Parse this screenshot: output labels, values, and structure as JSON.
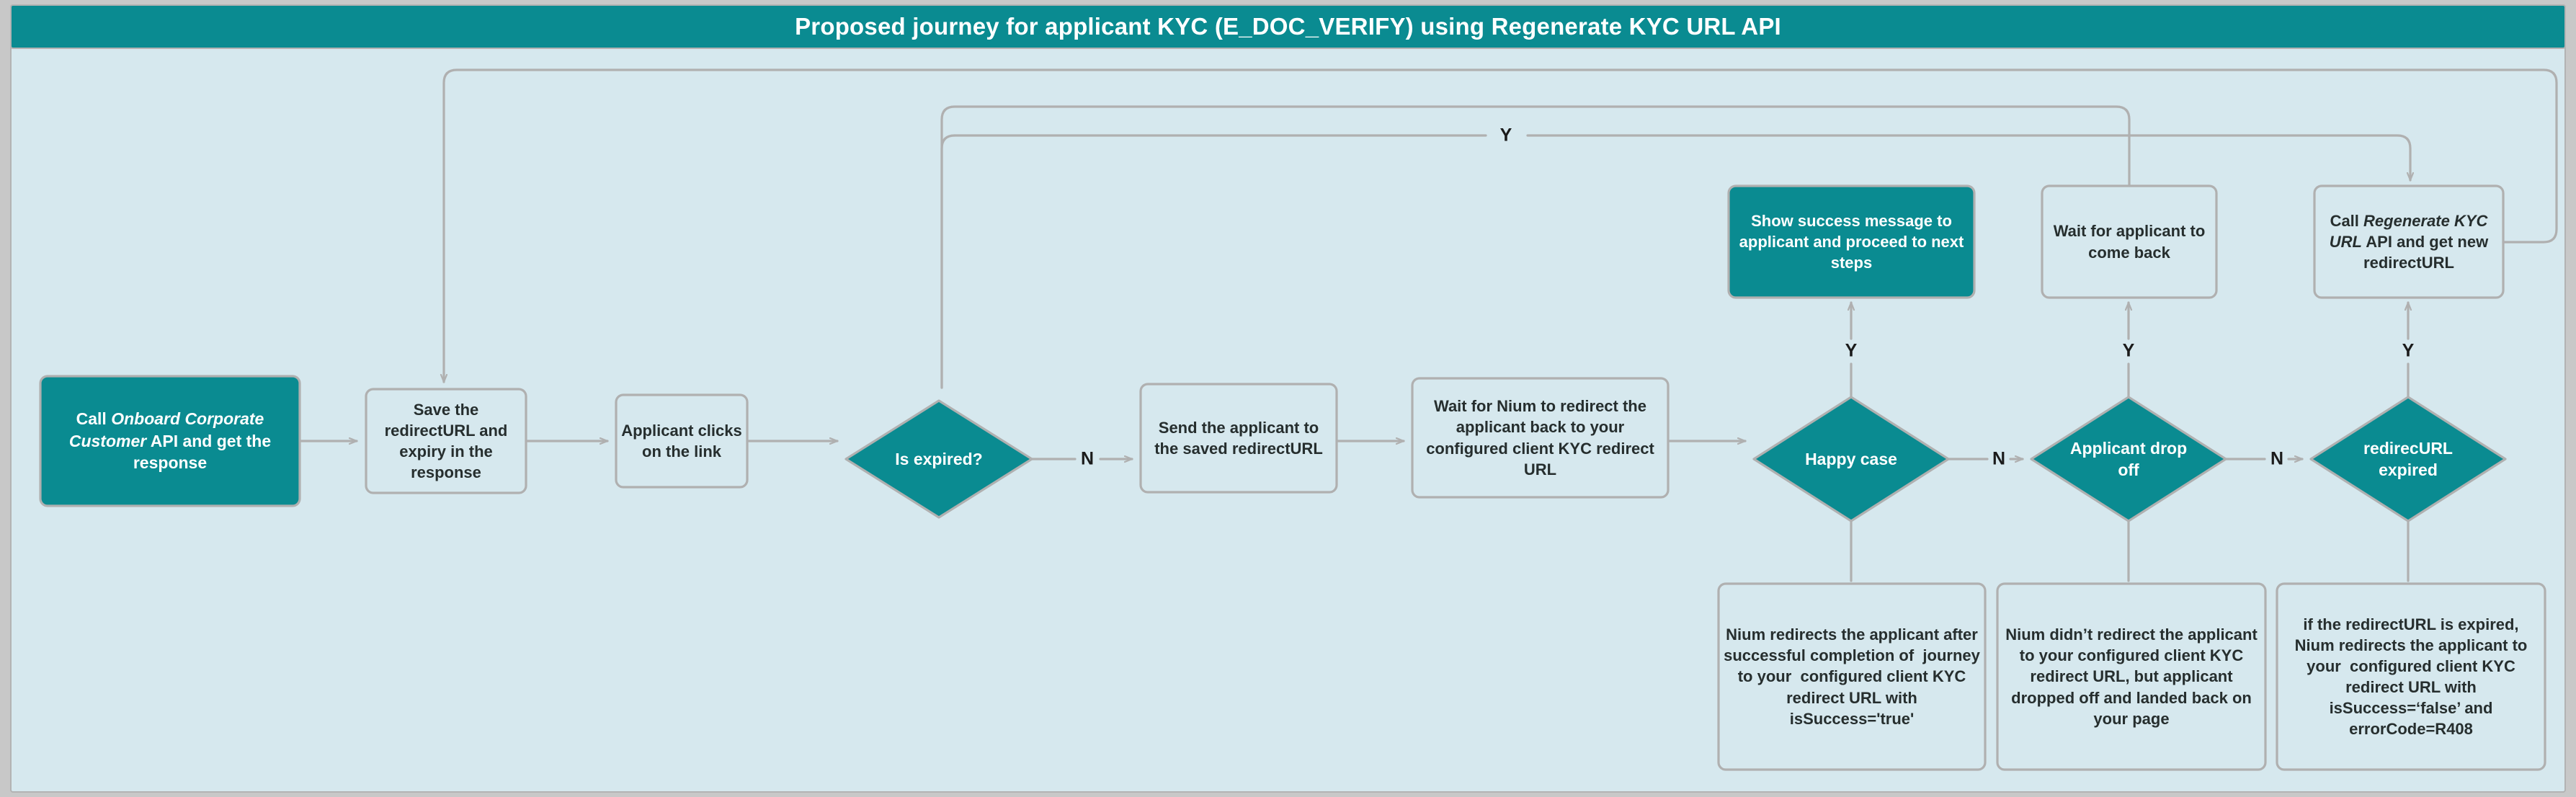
{
  "header": {
    "title": "Proposed journey for applicant KYC (E_DOC_VERIFY) using Regenerate KYC URL API"
  },
  "colors": {
    "canvas_background": "#d6e8ee",
    "accent_teal": "#0a8b91",
    "node_border": "#b0b0b0",
    "connector": "#b0b0b0",
    "text_dark": "#262e2e",
    "text_light": "#ffffff",
    "page_background": "#c8c8c8"
  },
  "nodes": [
    {
      "id": "onboard-api",
      "shape": "rect",
      "fill": "teal",
      "text": "Call Onboard Corporate Customer API and get the response",
      "html": "Call <em>Onboard Corporate Customer</em> API and get the response"
    },
    {
      "id": "save-redirecturl",
      "shape": "rect",
      "fill": "light",
      "text": "Save the redirectURL and expiry in the response",
      "html": "Save the redirectURL and expiry in the response"
    },
    {
      "id": "applicant-clicks-link",
      "shape": "rect",
      "fill": "light",
      "text": "Applicant clicks on the link",
      "html": "Applicant clicks on the link"
    },
    {
      "id": "is-expired",
      "shape": "diamond",
      "fill": "teal",
      "text": "Is expired?",
      "html": "Is expired?"
    },
    {
      "id": "send-applicant",
      "shape": "rect",
      "fill": "light",
      "text": "Send the applicant to the saved redirectURL",
      "html": "Send the applicant to the saved redirectURL"
    },
    {
      "id": "wait-for-nium",
      "shape": "rect",
      "fill": "light",
      "text": "Wait for Nium to redirect the applicant back to your configured client KYC redirect URL",
      "html": "Wait for Nium to redirect the applicant back to your configured client KYC redirect URL"
    },
    {
      "id": "happy-case",
      "shape": "diamond",
      "fill": "teal",
      "text": "Happy case",
      "html": "Happy case"
    },
    {
      "id": "applicant-drop-off",
      "shape": "diamond",
      "fill": "teal",
      "text": "Applicant drop off",
      "html": "Applicant drop off"
    },
    {
      "id": "redirecurl-expired",
      "shape": "diamond",
      "fill": "teal",
      "text": "redirecURL expired",
      "html": "redirecURL expired"
    },
    {
      "id": "show-success",
      "shape": "rect",
      "fill": "teal",
      "text": "Show success message to applicant and proceed to next steps",
      "html": "Show success message to applicant and proceed to next steps"
    },
    {
      "id": "wait-applicant-back",
      "shape": "rect",
      "fill": "light",
      "text": "Wait for applicant to come back",
      "html": "Wait for applicant to come back"
    },
    {
      "id": "regenerate-kyc-url",
      "shape": "rect",
      "fill": "light",
      "text": "Call Regenerate KYC URL API and get new redirectURL",
      "html": "Call <em>Regenerate KYC URL</em> API and get new redirectURL"
    },
    {
      "id": "note-happy",
      "shape": "rect",
      "fill": "light",
      "text": "Nium redirects the applicant after successful completion of  journey to your  configured client KYC redirect URL with isSuccess='true'",
      "html": "Nium redirects the applicant after successful completion of&nbsp; journey to your&nbsp; configured client KYC redirect URL with isSuccess='true'"
    },
    {
      "id": "note-dropoff",
      "shape": "rect",
      "fill": "light",
      "text": "Nium didn’t redirect the applicant to your configured client KYC redirect URL, but applicant dropped off and landed back on your page",
      "html": "Nium didn’t redirect the applicant to your configured client KYC redirect URL, but applicant dropped off and landed back on your page"
    },
    {
      "id": "note-expired",
      "shape": "rect",
      "fill": "light",
      "text": "if the redirectURL is expired, Nium redirects the applicant to your  configured client KYC redirect URL with isSuccess=‘false’ and errorCode=R408",
      "html": "if the redirectURL is expired, Nium redirects the applicant to your&nbsp; configured client KYC redirect URL with isSuccess=‘false’ and errorCode=R408"
    }
  ],
  "edge_labels": [
    {
      "id": "is-expired-no",
      "label": "N"
    },
    {
      "id": "happy-case-no",
      "label": "N"
    },
    {
      "id": "drop-off-no",
      "label": "N"
    },
    {
      "id": "happy-case-yes",
      "label": "Y"
    },
    {
      "id": "drop-off-yes",
      "label": "Y"
    },
    {
      "id": "expired-yes",
      "label": "Y"
    },
    {
      "id": "is-expired-yes",
      "label": "Y"
    }
  ]
}
